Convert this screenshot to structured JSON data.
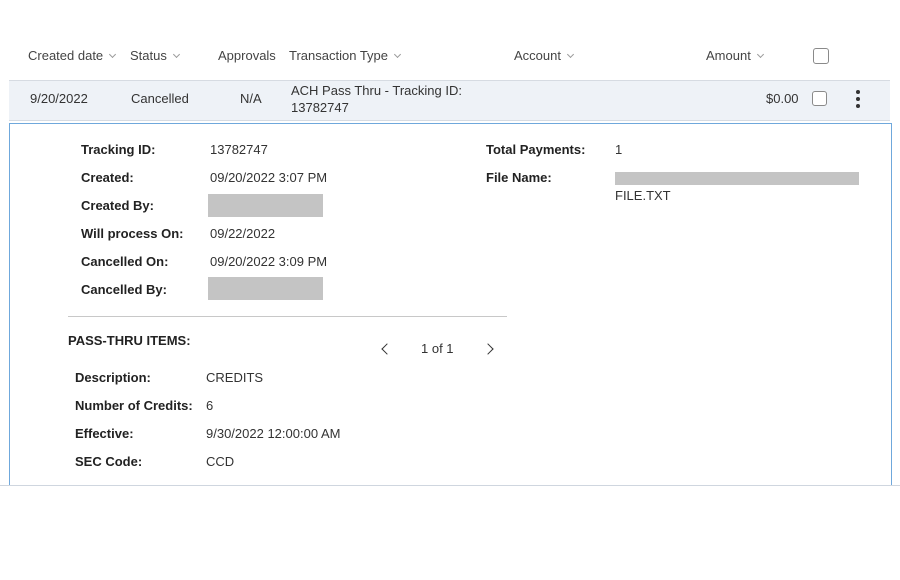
{
  "columns": {
    "created_date": "Created date",
    "status": "Status",
    "approvals": "Approvals",
    "transaction_type": "Transaction Type",
    "account": "Account",
    "amount": "Amount"
  },
  "row": {
    "created_date": "9/20/2022",
    "status": "Cancelled",
    "approvals": "N/A",
    "transaction_type_line1": "ACH Pass Thru - Tracking ID:",
    "transaction_type_line2": "13782747",
    "account": "",
    "amount": "$0.00"
  },
  "details": {
    "tracking_id_label": "Tracking ID:",
    "tracking_id": "13782747",
    "created_label": "Created:",
    "created": "09/20/2022 3:07 PM",
    "created_by_label": "Created By:",
    "will_process_label": "Will process On:",
    "will_process": "09/22/2022",
    "cancelled_on_label": "Cancelled On:",
    "cancelled_on": "09/20/2022 3:09 PM",
    "cancelled_by_label": "Cancelled By:",
    "total_payments_label": "Total Payments:",
    "total_payments": "1",
    "file_name_label": "File Name:",
    "file_name": "FILE.TXT"
  },
  "pass_thru": {
    "heading": "PASS-THRU ITEMS:",
    "pager": "1 of 1",
    "description_label": "Description:",
    "description": "CREDITS",
    "num_credits_label": "Number of Credits:",
    "num_credits": "6",
    "effective_label": "Effective:",
    "effective": "9/30/2022 12:00:00 AM",
    "sec_code_label": "SEC Code:",
    "sec_code": "CCD"
  },
  "icons": {
    "sort": "chevron-down-icon",
    "menu": "kebab-menu-icon",
    "prev": "chevron-left-icon",
    "next": "chevron-right-icon"
  },
  "colors": {
    "row_background": "#eef2f7",
    "panel_border": "#6fa8dc",
    "redaction": "#c4c4c4"
  }
}
